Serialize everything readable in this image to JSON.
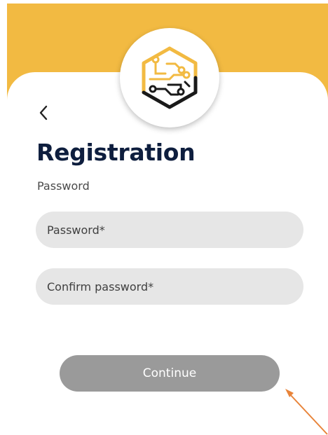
{
  "colors": {
    "header_background": "#F2BA42",
    "title": "#0E1E3E",
    "field_background": "#E6E6E6",
    "button_background": "#9A9A9A",
    "annotation_arrow": "#E8843A"
  },
  "header": {
    "logo_icon": "circuit-hexagon-logo"
  },
  "nav": {
    "back_icon": "chevron-left-icon"
  },
  "page": {
    "title": "Registration",
    "subtitle": "Password"
  },
  "form": {
    "password": {
      "placeholder": "Password*",
      "value": ""
    },
    "confirm_password": {
      "placeholder": "Confirm password*",
      "value": ""
    },
    "continue_label": "Continue"
  }
}
